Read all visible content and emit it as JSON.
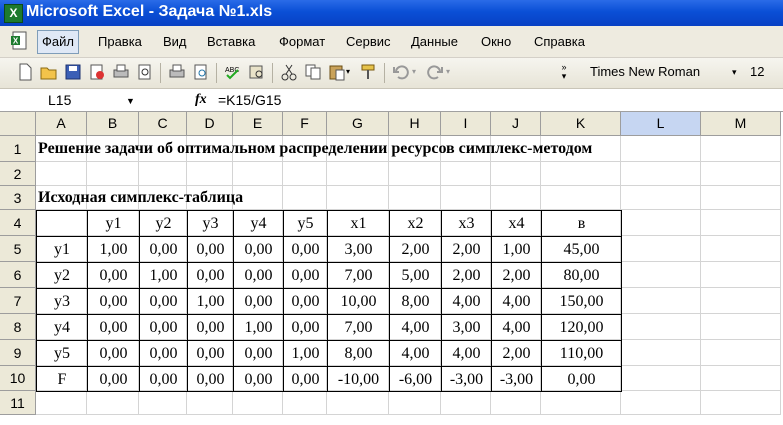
{
  "window": {
    "title": "Microsoft Excel - Задача №1.xls",
    "app_icon": "excel-icon"
  },
  "menu": [
    "Файл",
    "Правка",
    "Вид",
    "Вставка",
    "Формат",
    "Сервис",
    "Данные",
    "Окно",
    "Справка"
  ],
  "toolbar": {
    "font_name": "Times New Roman",
    "font_size": "12",
    "icons": [
      "new-icon",
      "open-icon",
      "save-icon",
      "permission-icon",
      "print-icon",
      "print-preview-icon",
      "print-icon-2",
      "research-icon",
      "spelling-icon",
      "research-icon-2",
      "cut-icon",
      "copy-icon",
      "paste-icon",
      "format-painter-icon",
      "undo-icon",
      "redo-icon"
    ]
  },
  "formula_bar": {
    "name_box": "L15",
    "fx": "fx",
    "formula": "=K15/G15"
  },
  "columns": [
    "A",
    "B",
    "C",
    "D",
    "E",
    "F",
    "G",
    "H",
    "I",
    "J",
    "K",
    "L",
    "M"
  ],
  "selected_column": "L",
  "rows": [
    "1",
    "2",
    "3",
    "4",
    "5",
    "6",
    "7",
    "8",
    "9",
    "10",
    "11"
  ],
  "sheet": {
    "title": "Решение задачи об оптимальном распределении ресурсов симплекс-методом",
    "subtitle": "Исходная симплекс-таблица",
    "table_header": [
      "",
      "y1",
      "y2",
      "y3",
      "y4",
      "y5",
      "x1",
      "x2",
      "x3",
      "x4",
      "в"
    ],
    "table_rows": [
      [
        "y1",
        "1,00",
        "0,00",
        "0,00",
        "0,00",
        "0,00",
        "3,00",
        "2,00",
        "2,00",
        "1,00",
        "45,00"
      ],
      [
        "y2",
        "0,00",
        "1,00",
        "0,00",
        "0,00",
        "0,00",
        "7,00",
        "5,00",
        "2,00",
        "2,00",
        "80,00"
      ],
      [
        "y3",
        "0,00",
        "0,00",
        "1,00",
        "0,00",
        "0,00",
        "10,00",
        "8,00",
        "4,00",
        "4,00",
        "150,00"
      ],
      [
        "y4",
        "0,00",
        "0,00",
        "0,00",
        "1,00",
        "0,00",
        "7,00",
        "4,00",
        "3,00",
        "4,00",
        "120,00"
      ],
      [
        "y5",
        "0,00",
        "0,00",
        "0,00",
        "0,00",
        "1,00",
        "8,00",
        "4,00",
        "4,00",
        "2,00",
        "110,00"
      ],
      [
        "F",
        "0,00",
        "0,00",
        "0,00",
        "0,00",
        "0,00",
        "-10,00",
        "-6,00",
        "-3,00",
        "-3,00",
        "0,00"
      ]
    ]
  }
}
